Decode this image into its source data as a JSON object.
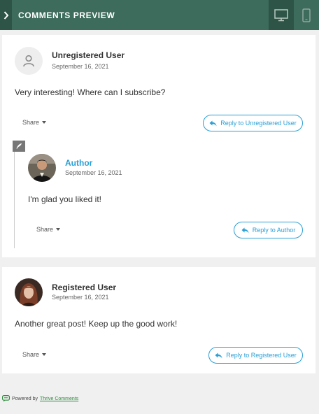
{
  "header": {
    "title": "COMMENTS PREVIEW",
    "toggle_icon": "chevron-right-icon",
    "devices": [
      {
        "name": "desktop-icon",
        "active": true
      },
      {
        "name": "mobile-icon",
        "active": false
      }
    ]
  },
  "comments": [
    {
      "author": "Unregistered User",
      "date": "September 16, 2021",
      "text": "Very interesting! Where can I subscribe?",
      "share_label": "Share",
      "reply_label": "Reply to Unregistered User",
      "avatar": "default-user-avatar"
    },
    {
      "author": "Author",
      "date": "September 16, 2021",
      "text": "I'm glad you liked it!",
      "share_label": "Share",
      "reply_label": "Reply to Author",
      "avatar": "author-photo-avatar",
      "is_reply": true
    },
    {
      "author": "Registered User",
      "date": "September 16, 2021",
      "text": "Another great post! Keep up the good work!",
      "share_label": "Share",
      "reply_label": "Reply to Registered User",
      "avatar": "registered-user-photo-avatar"
    }
  ],
  "footer": {
    "prefix": "Powered by",
    "link": "Thrive Comments"
  },
  "colors": {
    "header_bg": "#3d6b5c",
    "header_dark": "#2d5446",
    "accent": "#2a9fd6",
    "footer_link": "#2e8b3e"
  }
}
